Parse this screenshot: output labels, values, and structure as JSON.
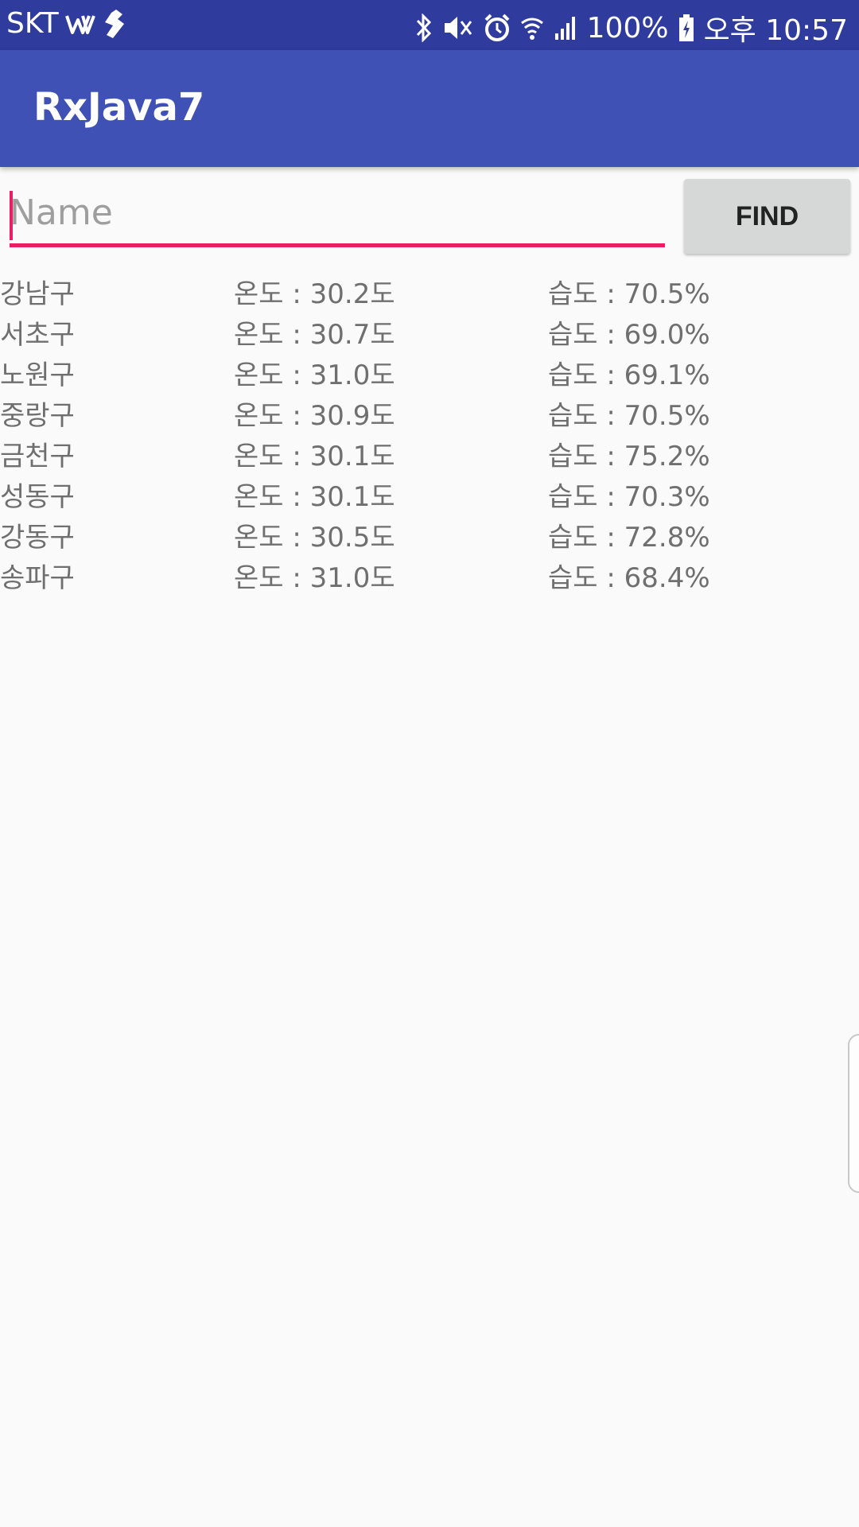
{
  "status_bar": {
    "carrier": "SKT",
    "battery": "100%",
    "time": "오후 10:57",
    "icons": [
      "w-icon",
      "runner-icon",
      "bluetooth-icon",
      "mute-icon",
      "alarm-icon",
      "wifi-icon",
      "signal-icon",
      "battery-icon"
    ]
  },
  "app_bar": {
    "title": "RxJava7"
  },
  "search": {
    "placeholder": "Name",
    "value": "",
    "button_label": "FIND"
  },
  "weather": [
    {
      "district": "강남구",
      "temp": "온도 : 30.2도",
      "humidity": "습도 : 70.5%"
    },
    {
      "district": "서초구",
      "temp": "온도 : 30.7도",
      "humidity": "습도 : 69.0%"
    },
    {
      "district": "노원구",
      "temp": "온도 : 31.0도",
      "humidity": "습도 : 69.1%"
    },
    {
      "district": "중랑구",
      "temp": "온도 : 30.9도",
      "humidity": "습도 : 70.5%"
    },
    {
      "district": "금천구",
      "temp": "온도 : 30.1도",
      "humidity": "습도 : 75.2%"
    },
    {
      "district": "성동구",
      "temp": "온도 : 30.1도",
      "humidity": "습도 : 70.3%"
    },
    {
      "district": "강동구",
      "temp": "온도 : 30.5도",
      "humidity": "습도 : 72.8%"
    },
    {
      "district": "송파구",
      "temp": "온도 : 31.0도",
      "humidity": "습도 : 68.4%"
    }
  ],
  "colors": {
    "status_bar": "#2f3c9e",
    "app_bar": "#3f51b5",
    "accent": "#e91e63",
    "button": "#d6d7d7",
    "text": "#6f6f6f",
    "background": "#fafafa"
  }
}
